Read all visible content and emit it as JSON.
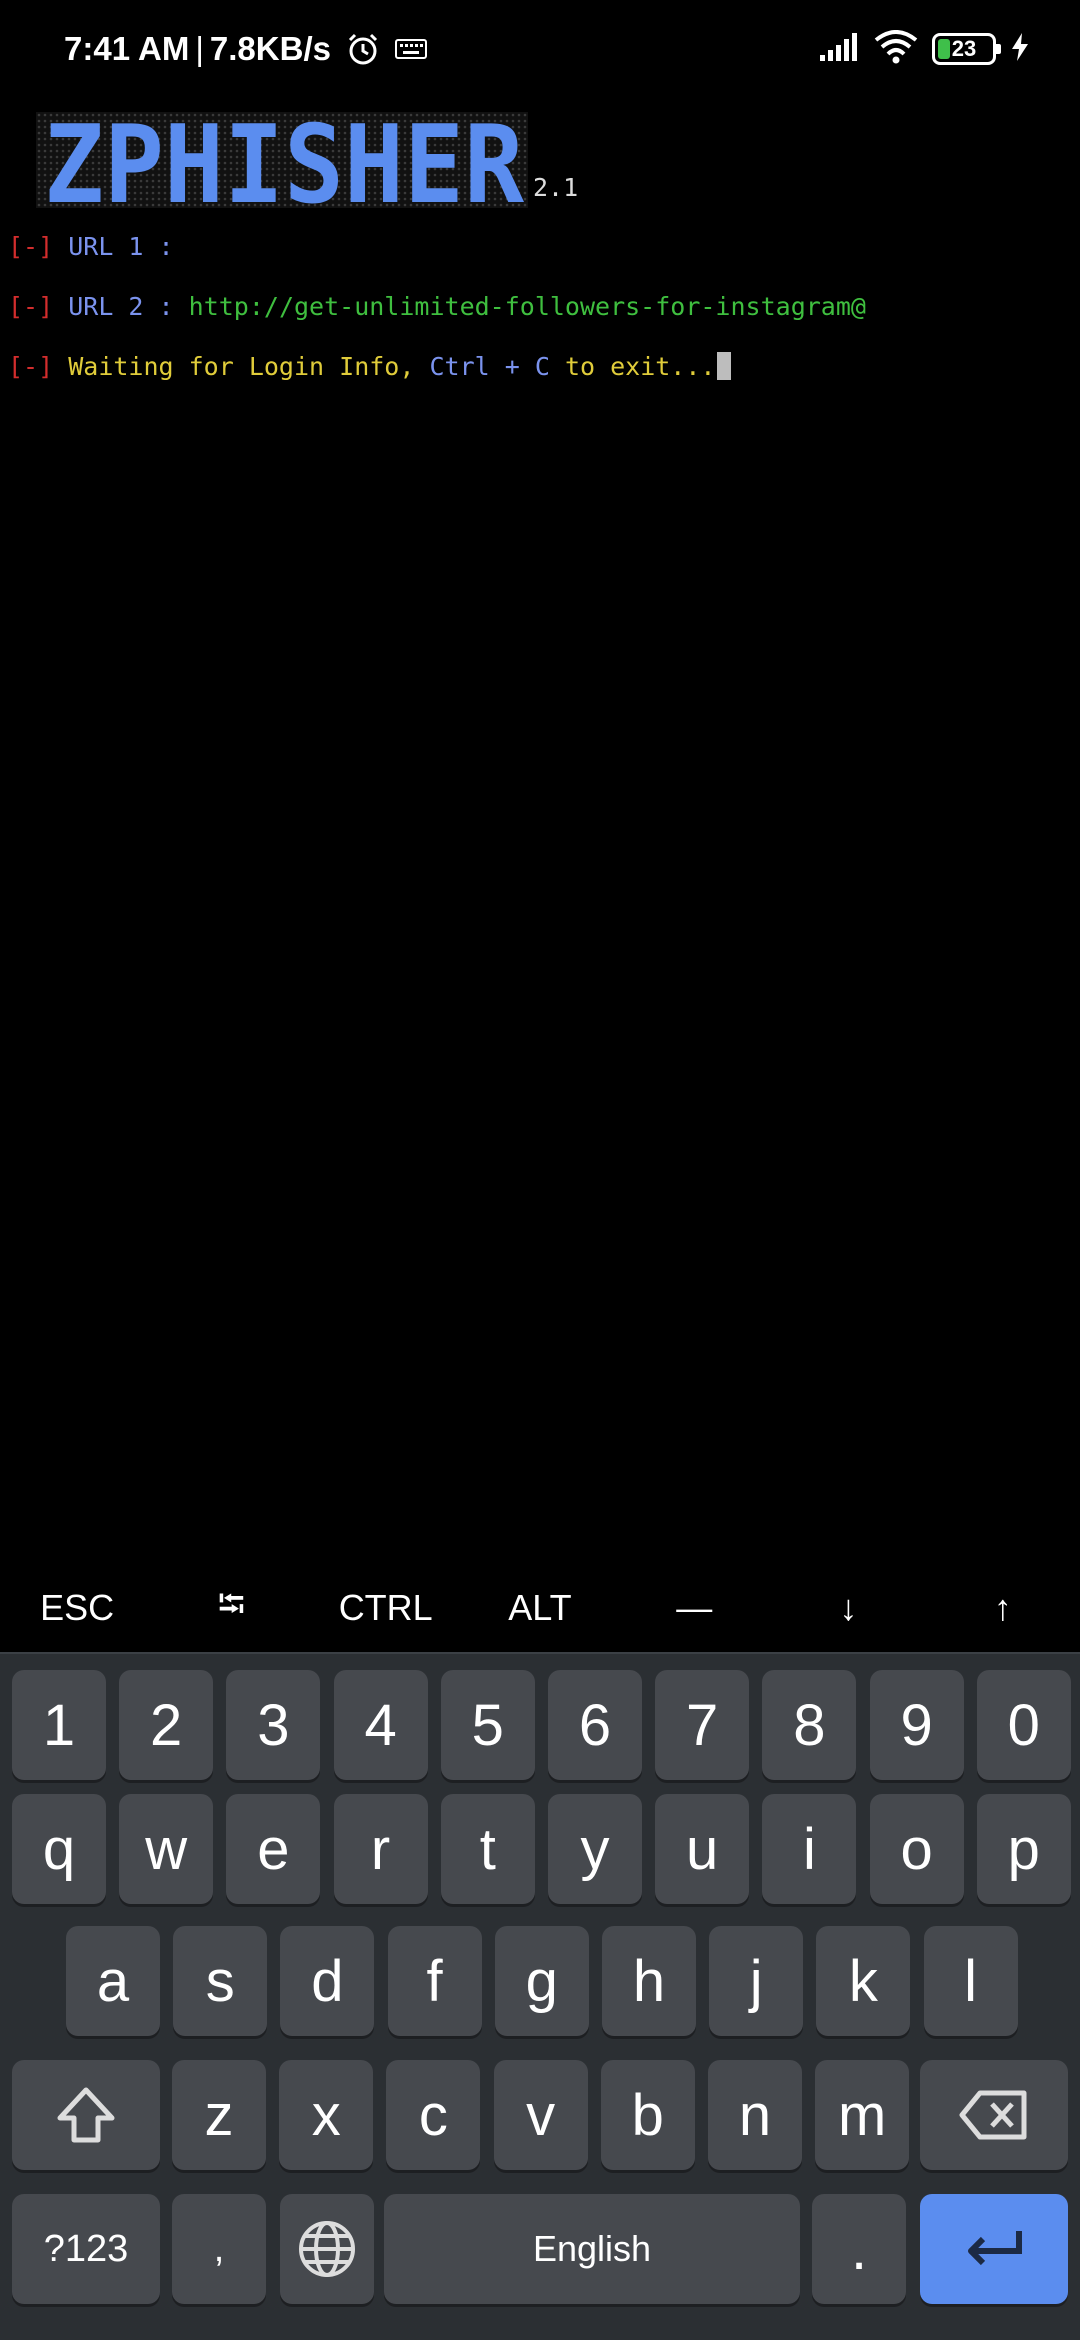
{
  "status_bar": {
    "time": "7:41 AM",
    "separator": "|",
    "net_speed": "7.8KB/s",
    "battery": "23",
    "battery_level_percent": 23,
    "icons": [
      "alarm-icon",
      "keyboard-icon",
      "signal-icon",
      "wifi-icon",
      "battery-icon",
      "charging-icon"
    ]
  },
  "terminal": {
    "banner_text": "ZPHISHER",
    "version": "2.1",
    "lines": [
      {
        "prefix": "[-]",
        "label": "URL 1 :",
        "value": ""
      },
      {
        "prefix": "[-]",
        "label": "URL 2 :",
        "value": "http://get-unlimited-followers-for-instagram@"
      },
      {
        "prefix": "[-]",
        "msg1": "Waiting for Login Info,",
        "msg2": "Ctrl + C",
        "msg3": "to exit..."
      }
    ]
  },
  "extra_keys": [
    "ESC",
    "⭾",
    "CTRL",
    "ALT",
    "—",
    "↓",
    "↑"
  ],
  "keyboard": {
    "row_numbers": [
      "1",
      "2",
      "3",
      "4",
      "5",
      "6",
      "7",
      "8",
      "9",
      "0"
    ],
    "row_top": [
      "q",
      "w",
      "e",
      "r",
      "t",
      "y",
      "u",
      "i",
      "o",
      "p"
    ],
    "row_middle": [
      "a",
      "s",
      "d",
      "f",
      "g",
      "h",
      "j",
      "k",
      "l"
    ],
    "row_bottom": [
      "z",
      "x",
      "c",
      "v",
      "b",
      "n",
      "m"
    ],
    "symbols_label": "?123",
    "comma_label": ",",
    "space_label": "English",
    "period_label": "."
  },
  "colors": {
    "background": "#000000",
    "keyboard_bg": "#2b2f33",
    "key_bg": "#46494e",
    "enter_key": "#5b8def",
    "banner_blue": "#5b8def",
    "url_green": "#3fbf3f",
    "prefix_red": "#d32d2d",
    "label_blue": "#7b93ee",
    "message_yellow": "#e0cc3a"
  }
}
